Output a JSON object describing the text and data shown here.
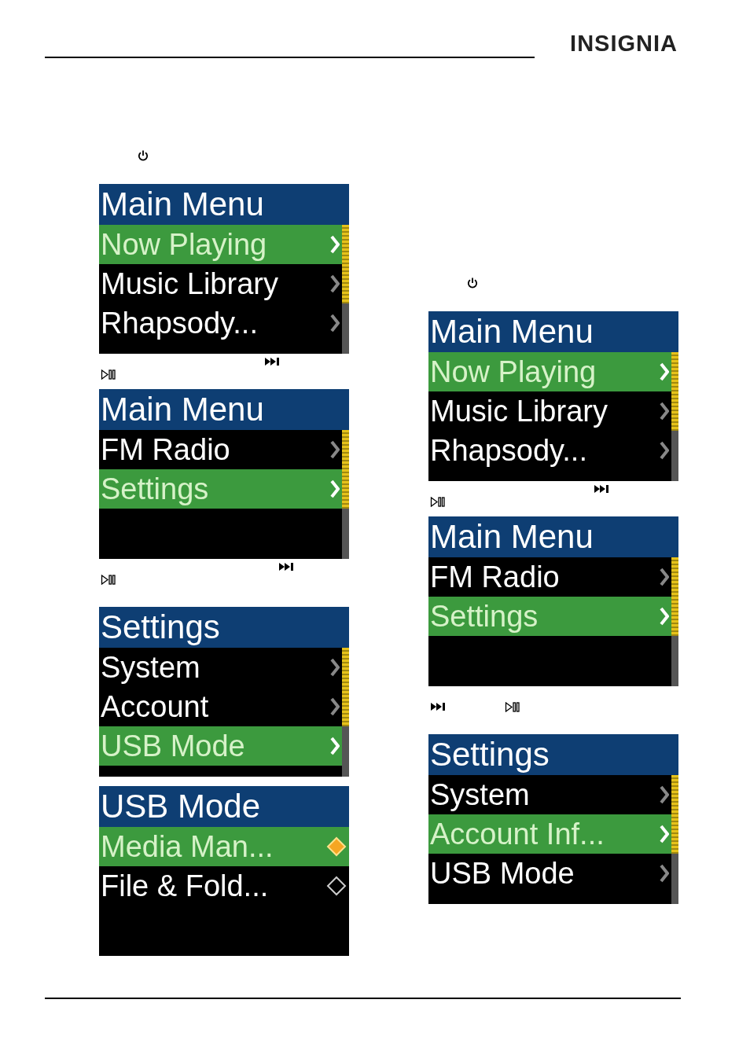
{
  "header": {
    "logo": "INSIGNIA"
  },
  "columns": [
    {
      "items": [
        {
          "kind": "power"
        },
        {
          "kind": "screen",
          "title": "Main Menu",
          "scrollbar": true,
          "rows": [
            {
              "kind": "menu",
              "label": "Now Playing",
              "selected": true
            },
            {
              "kind": "menu",
              "label": "Music Library",
              "selected": false
            },
            {
              "kind": "menu",
              "label": "Rhapsody...",
              "selected": false
            }
          ]
        },
        {
          "kind": "controls-stacked"
        },
        {
          "kind": "screen",
          "title": "Main Menu",
          "scrollbar": true,
          "rows": [
            {
              "kind": "menu",
              "label": "FM Radio",
              "selected": false
            },
            {
              "kind": "menu",
              "label": "Settings",
              "selected": true
            }
          ]
        },
        {
          "kind": "controls-stacked"
        },
        {
          "kind": "screen",
          "title": "Settings",
          "scrollbar": true,
          "rows": [
            {
              "kind": "menu",
              "label": "System",
              "selected": false
            },
            {
              "kind": "menu",
              "label": "Account",
              "selected": false
            },
            {
              "kind": "menu",
              "label": "USB Mode",
              "selected": true
            }
          ]
        },
        {
          "kind": "screen",
          "title": "USB Mode",
          "scrollbar": false,
          "rows": [
            {
              "kind": "option",
              "label": "Media Man...",
              "selected": true,
              "checked": true
            },
            {
              "kind": "option",
              "label": "File & Fold...",
              "selected": false,
              "checked": false
            }
          ]
        }
      ]
    },
    {
      "items": [
        {
          "kind": "power"
        },
        {
          "kind": "screen",
          "title": "Main Menu",
          "scrollbar": true,
          "rows": [
            {
              "kind": "menu",
              "label": "Now Playing",
              "selected": true
            },
            {
              "kind": "menu",
              "label": "Music Library",
              "selected": false
            },
            {
              "kind": "menu",
              "label": "Rhapsody...",
              "selected": false
            }
          ]
        },
        {
          "kind": "controls-stacked"
        },
        {
          "kind": "screen",
          "title": "Main Menu",
          "scrollbar": true,
          "rows": [
            {
              "kind": "menu",
              "label": "FM Radio",
              "selected": false
            },
            {
              "kind": "menu",
              "label": "Settings",
              "selected": true
            }
          ]
        },
        {
          "kind": "controls-inline"
        },
        {
          "kind": "screen",
          "title": "Settings",
          "scrollbar": true,
          "rows": [
            {
              "kind": "menu",
              "label": "System",
              "selected": false
            },
            {
              "kind": "menu",
              "label": "Account Inf...",
              "selected": true
            },
            {
              "kind": "menu",
              "label": "USB Mode",
              "selected": false
            }
          ]
        }
      ]
    }
  ]
}
